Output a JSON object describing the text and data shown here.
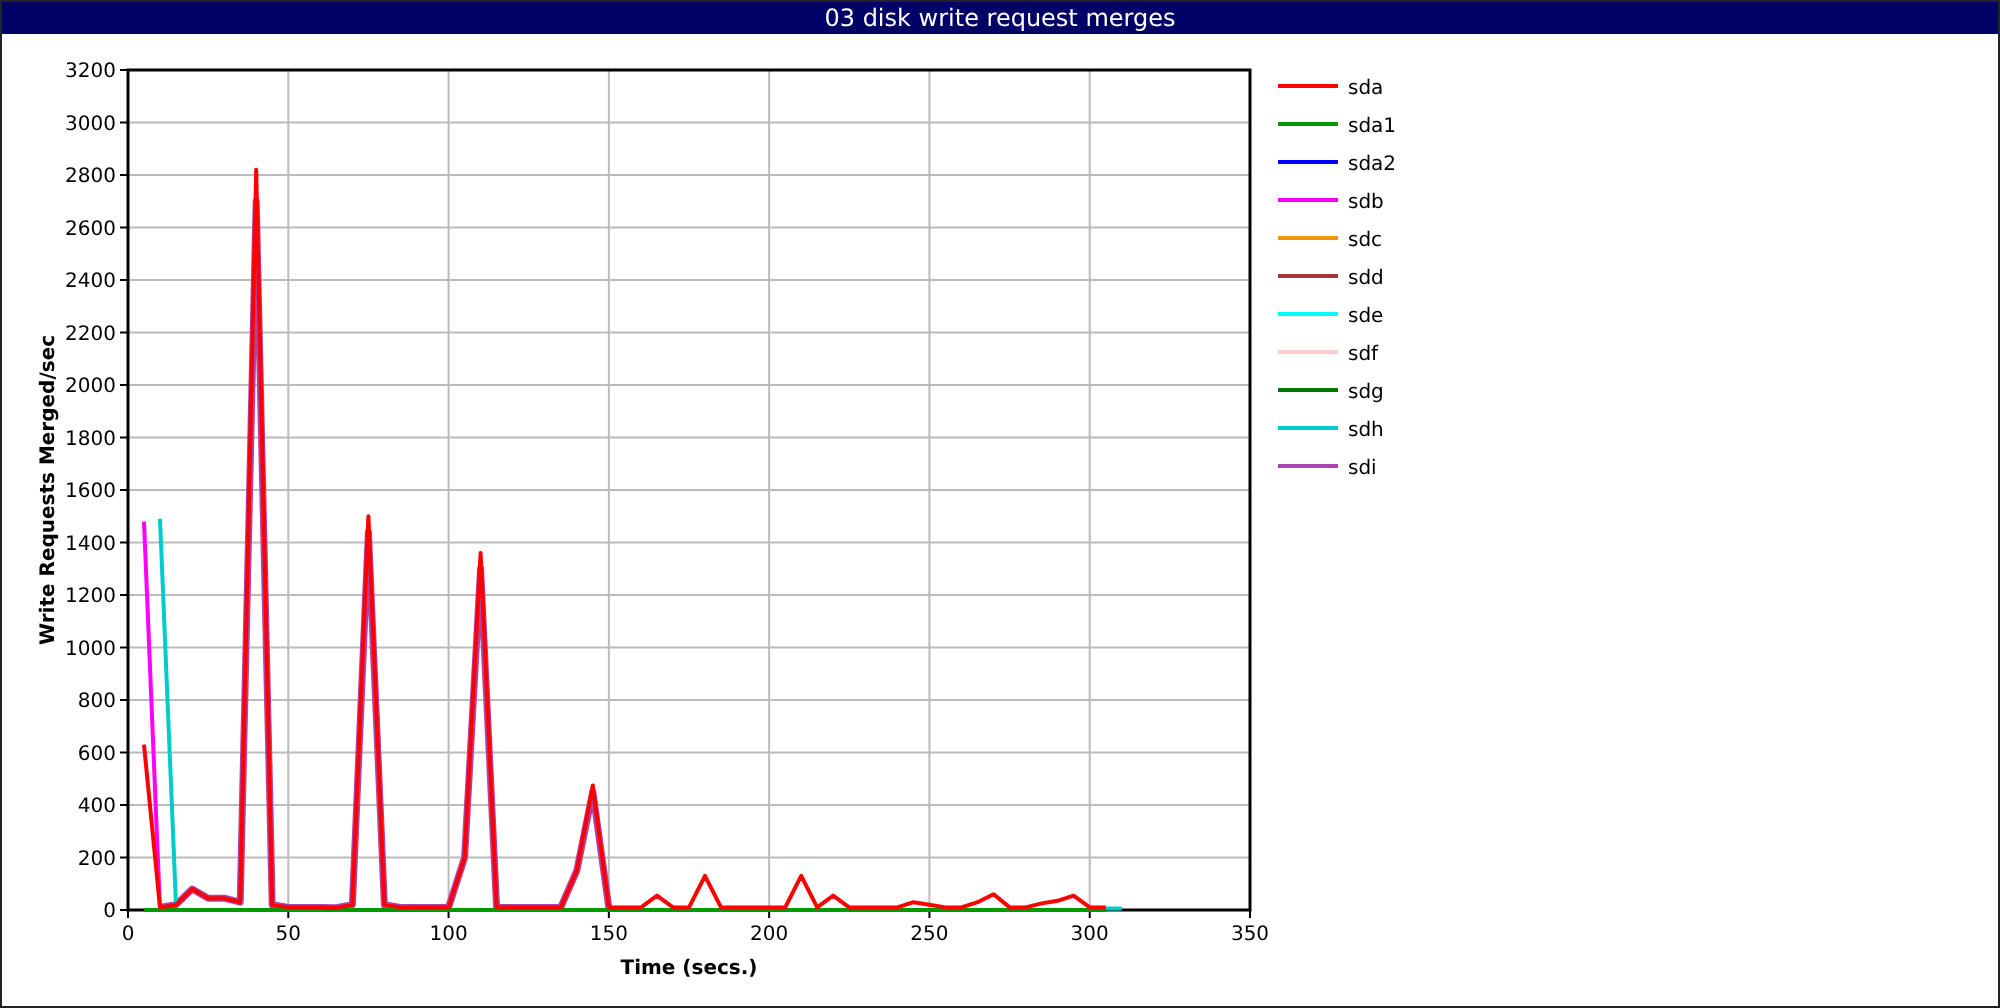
{
  "title": "03 disk write request merges",
  "chart_data": {
    "type": "line",
    "xlabel": "Time (secs.)",
    "ylabel": "Write Requests Merged/sec",
    "xlim": [
      0,
      350
    ],
    "ylim": [
      0,
      3200
    ],
    "grid": true,
    "legend": true,
    "xticks": [
      0,
      50,
      100,
      150,
      200,
      250,
      300,
      350
    ],
    "yticks": [
      0,
      200,
      400,
      600,
      800,
      1000,
      1200,
      1400,
      1600,
      1800,
      2000,
      2200,
      2400,
      2600,
      2800,
      3000,
      3200
    ],
    "x": [
      5,
      10,
      15,
      20,
      25,
      30,
      35,
      40,
      45,
      50,
      55,
      60,
      65,
      70,
      75,
      80,
      85,
      90,
      95,
      100,
      105,
      110,
      115,
      120,
      125,
      130,
      135,
      140,
      145,
      150,
      155,
      160,
      165,
      170,
      175,
      180,
      185,
      190,
      195,
      200,
      205,
      210,
      215,
      220,
      225,
      230,
      235,
      240,
      245,
      250,
      255,
      260,
      265,
      270,
      275,
      280,
      285,
      290,
      295,
      300,
      305,
      310
    ],
    "series": [
      {
        "name": "sda",
        "color": "#ff0000",
        "values": [
          630,
          10,
          20,
          80,
          45,
          45,
          30,
          2820,
          20,
          10,
          10,
          10,
          8,
          20,
          1500,
          20,
          10,
          10,
          10,
          10,
          200,
          1360,
          10,
          10,
          10,
          10,
          10,
          150,
          475,
          10,
          10,
          10,
          55,
          10,
          10,
          130,
          10,
          10,
          10,
          10,
          10,
          130,
          10,
          55,
          10,
          10,
          10,
          10,
          30,
          20,
          10,
          10,
          30,
          60,
          10,
          10,
          25,
          35,
          55,
          10,
          10,
          null
        ]
      },
      {
        "name": "sda1",
        "color": "#009900",
        "values": [
          0,
          0,
          0,
          0,
          0,
          0,
          0,
          0,
          0,
          0,
          0,
          0,
          0,
          0,
          0,
          0,
          0,
          0,
          0,
          0,
          0,
          0,
          0,
          0,
          0,
          0,
          0,
          0,
          0,
          0,
          0,
          0,
          0,
          0,
          0,
          0,
          0,
          0,
          0,
          0,
          0,
          0,
          0,
          0,
          0,
          0,
          0,
          0,
          0,
          0,
          0,
          0,
          0,
          0,
          0,
          0,
          0,
          0,
          0,
          0,
          0,
          null
        ]
      },
      {
        "name": "sda2",
        "color": "#0000ff",
        "values": [
          null,
          null,
          null,
          null,
          null,
          null,
          null,
          null,
          null,
          null,
          null,
          null,
          null,
          null,
          null,
          null,
          null,
          null,
          null,
          null,
          null,
          null,
          null,
          null,
          null,
          null,
          null,
          null,
          null,
          null,
          null,
          null,
          null,
          null,
          null,
          null,
          null,
          null,
          null,
          null,
          null,
          null,
          null,
          null,
          null,
          null,
          null,
          null,
          null,
          null,
          null,
          null,
          null,
          null,
          null,
          null,
          null,
          null,
          null,
          null,
          null,
          null
        ]
      },
      {
        "name": "sdb",
        "color": "#ff00ff",
        "values": [
          1480,
          0,
          null,
          null,
          null,
          null,
          null,
          null,
          null,
          null,
          null,
          null,
          null,
          null,
          null,
          null,
          null,
          null,
          null,
          null,
          null,
          null,
          null,
          null,
          null,
          null,
          null,
          null,
          null,
          null,
          null,
          null,
          null,
          null,
          null,
          null,
          null,
          null,
          null,
          null,
          null,
          null,
          null,
          null,
          null,
          null,
          null,
          null,
          null,
          null,
          null,
          null,
          null,
          null,
          null,
          null,
          null,
          null,
          null,
          null,
          null,
          null
        ]
      },
      {
        "name": "sdc",
        "color": "#ee9900",
        "values": [
          null,
          null,
          null,
          null,
          null,
          null,
          null,
          null,
          null,
          null,
          null,
          null,
          null,
          null,
          null,
          null,
          null,
          null,
          null,
          null,
          null,
          null,
          null,
          null,
          null,
          null,
          null,
          null,
          null,
          null,
          null,
          null,
          null,
          null,
          null,
          null,
          null,
          null,
          null,
          null,
          null,
          null,
          null,
          null,
          null,
          null,
          null,
          null,
          null,
          null,
          null,
          null,
          null,
          null,
          null,
          null,
          null,
          null,
          null,
          null,
          null,
          null
        ]
      },
      {
        "name": "sdd",
        "color": "#aa3333",
        "values": [
          null,
          null,
          null,
          null,
          null,
          null,
          null,
          null,
          null,
          null,
          null,
          null,
          null,
          null,
          null,
          null,
          null,
          null,
          null,
          null,
          null,
          null,
          null,
          null,
          null,
          null,
          null,
          null,
          null,
          null,
          null,
          null,
          null,
          null,
          null,
          null,
          null,
          null,
          null,
          null,
          null,
          null,
          null,
          null,
          null,
          null,
          null,
          null,
          null,
          null,
          null,
          null,
          null,
          null,
          null,
          null,
          null,
          null,
          null,
          null,
          null,
          null
        ]
      },
      {
        "name": "sde",
        "color": "#00ffff",
        "values": [
          null,
          null,
          null,
          null,
          null,
          null,
          null,
          null,
          null,
          null,
          null,
          null,
          null,
          null,
          null,
          null,
          null,
          null,
          null,
          null,
          null,
          null,
          null,
          null,
          null,
          null,
          null,
          null,
          null,
          null,
          null,
          null,
          null,
          null,
          null,
          null,
          null,
          null,
          null,
          null,
          null,
          null,
          null,
          null,
          null,
          null,
          null,
          null,
          null,
          null,
          null,
          null,
          null,
          null,
          null,
          null,
          null,
          null,
          null,
          null,
          null,
          null
        ]
      },
      {
        "name": "sdf",
        "color": "#ffcccc",
        "values": [
          null,
          null,
          null,
          null,
          null,
          null,
          null,
          null,
          null,
          null,
          null,
          null,
          null,
          null,
          null,
          null,
          null,
          null,
          null,
          null,
          null,
          null,
          null,
          null,
          null,
          null,
          null,
          null,
          null,
          null,
          null,
          null,
          null,
          null,
          null,
          null,
          null,
          null,
          null,
          null,
          null,
          null,
          null,
          null,
          null,
          null,
          null,
          null,
          null,
          null,
          null,
          null,
          null,
          null,
          null,
          null,
          null,
          null,
          null,
          null,
          null,
          null
        ]
      },
      {
        "name": "sdg",
        "color": "#007700",
        "values": [
          null,
          null,
          null,
          null,
          null,
          null,
          null,
          null,
          null,
          null,
          null,
          null,
          null,
          null,
          null,
          null,
          null,
          null,
          null,
          null,
          null,
          null,
          null,
          null,
          null,
          null,
          null,
          null,
          null,
          null,
          null,
          null,
          null,
          null,
          null,
          null,
          null,
          null,
          null,
          null,
          null,
          null,
          null,
          null,
          null,
          null,
          null,
          null,
          null,
          null,
          null,
          null,
          null,
          null,
          null,
          null,
          null,
          null,
          null,
          null,
          null,
          null
        ]
      },
      {
        "name": "sdh",
        "color": "#00cccc",
        "values": [
          null,
          1490,
          20,
          null,
          null,
          null,
          null,
          null,
          null,
          null,
          null,
          null,
          null,
          null,
          null,
          null,
          null,
          null,
          null,
          null,
          null,
          null,
          null,
          null,
          null,
          null,
          null,
          null,
          null,
          null,
          null,
          null,
          null,
          null,
          null,
          null,
          null,
          null,
          null,
          null,
          null,
          null,
          null,
          null,
          null,
          null,
          null,
          null,
          null,
          null,
          null,
          null,
          null,
          null,
          null,
          null,
          null,
          null,
          null,
          null,
          5,
          5
        ]
      },
      {
        "name": "sdi",
        "color": "#aa44aa",
        "values": [
          null,
          10,
          20,
          80,
          45,
          45,
          30,
          2700,
          20,
          10,
          10,
          10,
          8,
          20,
          1440,
          20,
          10,
          10,
          10,
          10,
          200,
          1300,
          10,
          10,
          10,
          10,
          10,
          150,
          450,
          10,
          null,
          null,
          null,
          null,
          null,
          null,
          null,
          null,
          null,
          null,
          null,
          null,
          null,
          null,
          null,
          null,
          null,
          null,
          null,
          null,
          null,
          null,
          null,
          null,
          null,
          null,
          null,
          null,
          null,
          null,
          null,
          null
        ]
      }
    ]
  }
}
